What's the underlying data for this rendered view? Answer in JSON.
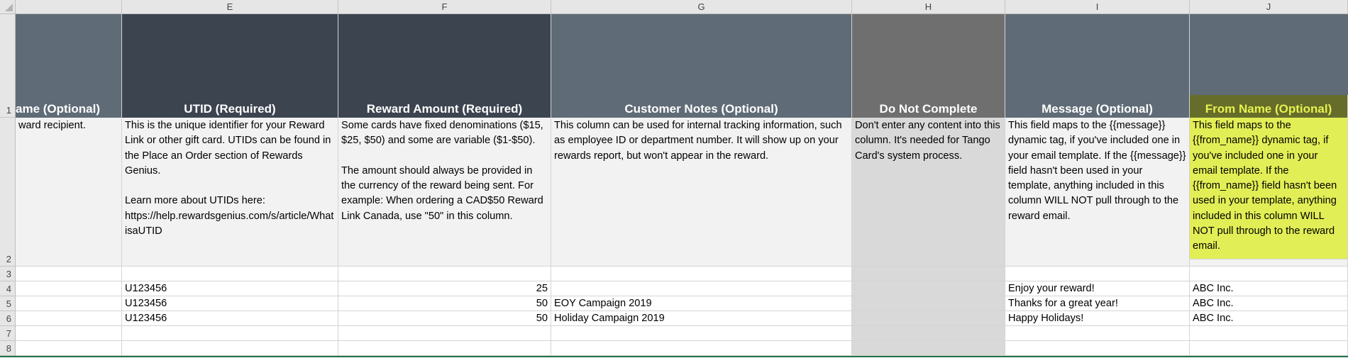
{
  "spreadsheet": {
    "columns": [
      "E",
      "F",
      "G",
      "H",
      "I",
      "J"
    ],
    "rows": [
      "1",
      "2",
      "3",
      "4",
      "5",
      "6",
      "7",
      "8"
    ],
    "headers": {
      "D": "ame (Optional)",
      "E": "UTID (Required)",
      "F": "Reward Amount (Required)",
      "G": "Customer Notes (Optional)",
      "H": "Do Not Complete",
      "I": "Message (Optional)",
      "J": "From Name (Optional)"
    },
    "descriptions": {
      "D": "ward recipient.",
      "E": "This is the unique identifier for your Reward Link or other gift card. UTIDs can be found in the Place an Order section of Rewards Genius.\n\nLearn more about UTIDs here: https://help.rewardsgenius.com/s/article/WhatisaUTID",
      "F": "Some cards have fixed denominations ($15, $25, $50) and some are variable ($1-$50).\n\nThe amount should always be provided in the currency of the reward being sent. For example: When ordering a CAD$50 Reward Link Canada, use \"50\" in this column.",
      "G": "This column can be used for internal tracking information, such as employee ID or department number. It will show up on your rewards report, but won't appear in the reward.",
      "H": "Don't enter any content into this column. It's needed for Tango Card's system process.",
      "I": "This field maps to the {{message}} dynamic tag, if you've included one in your email template. If the {{message}} field hasn't been used in your template, anything included in this column WILL NOT pull through to the reward email.",
      "J": "This field maps to the {{from_name}} dynamic tag, if you've included one in your email template. If the {{from_name}} field hasn't been used in your template, anything included in this column WILL NOT pull through to the reward email."
    },
    "data_rows": [
      {
        "row": "4",
        "E": "U123456",
        "F": "25",
        "G": "",
        "I": "Enjoy your reward!",
        "J": "ABC Inc."
      },
      {
        "row": "5",
        "E": "U123456",
        "F": "50",
        "G": "EOY Campaign 2019",
        "I": "Thanks for a great year!",
        "J": "ABC Inc."
      },
      {
        "row": "6",
        "E": "U123456",
        "F": "50",
        "G": "Holiday Campaign 2019",
        "I": "Happy Holidays!",
        "J": "ABC Inc."
      }
    ],
    "colors": {
      "header_dark": "#3c4450",
      "header_slate": "#5f6b76",
      "header_gray": "#6f6f6f",
      "do_not_complete_fill": "#d9d9d9",
      "highlight_fill": "#e2ee55",
      "highlight_header_text": "#e6f24f",
      "selection_green": "#217346"
    }
  }
}
